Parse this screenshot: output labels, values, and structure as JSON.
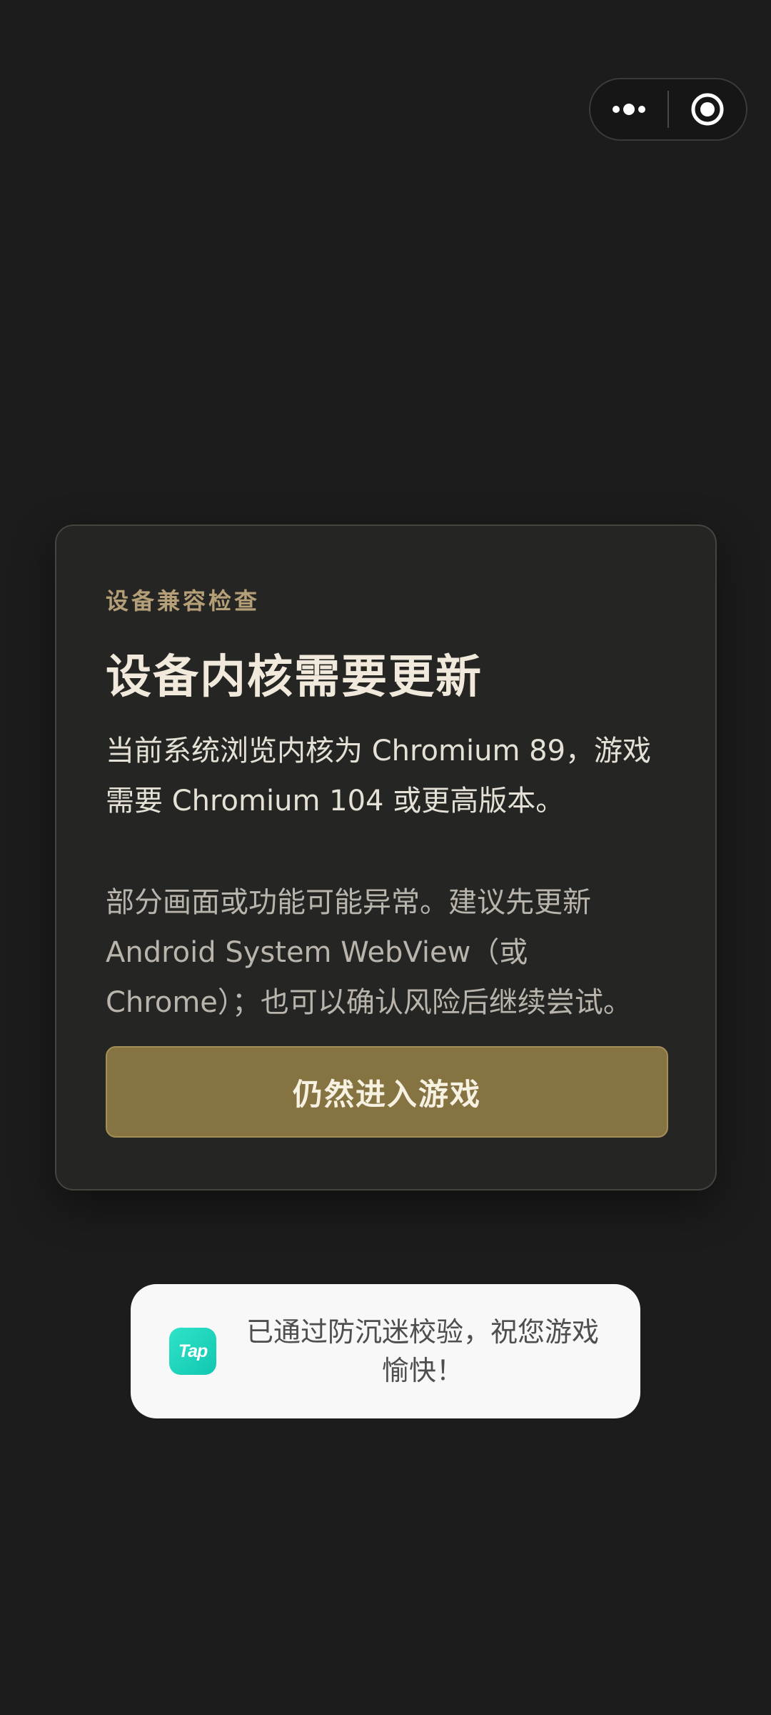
{
  "capsule": {
    "more_icon": "more-dots-icon",
    "close_icon": "target-circle-icon"
  },
  "dialog": {
    "eyebrow": "设备兼容检查",
    "title": "设备内核需要更新",
    "description": "当前系统浏览内核为 Chromium 89，游戏需要 Chromium 104 或更高版本。",
    "note": "部分画面或功能可能异常。建议先更新 Android System WebView（或 Chrome）；也可以确认风险后继续尝试。",
    "enter_button": "仍然进入游戏"
  },
  "toast": {
    "logo_text": "Tap",
    "message": "已通过防沉迷校验，祝您游戏愉快！"
  },
  "colors": {
    "background": "#1c1c1c",
    "accent_gold": "#857342",
    "eyebrow_gold": "#b59f78",
    "tap_teal": "#18d0b8"
  }
}
